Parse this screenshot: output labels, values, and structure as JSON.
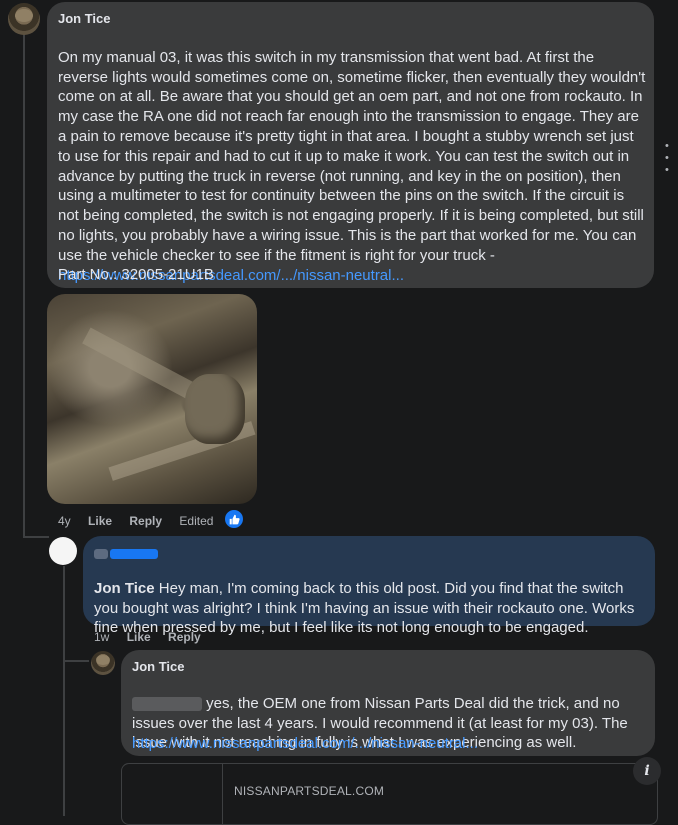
{
  "comment_1": {
    "author": "Jon Tice",
    "text": "On my manual 03, it was this switch in my transmission that went bad. At first the reverse lights would sometimes come on, sometime flicker, then eventually they wouldn't come on at all. Be aware that you should get an oem part, and not one from rockauto. In my case the RA one did not reach far enough into the transmission to engage. They are a pain to remove because it's pretty tight in that area. I bought a stubby wrench set just to use for this repair and had to cut it up to make it work. You can test the switch out in advance by putting the truck in reverse (not running, and key in the on position), then using a multimeter to test for continuity between the pins on the switch. If the circuit is not being completed, the switch is not engaging properly. If it is being completed, but still no lights, you probably have a wiring issue. This is the part that worked for me. You can use the vehicle checker to see if the fitment is right for your truck - ",
    "link": "https://www.nissanpartsdeal.com/.../nissan-neutral...",
    "part_no": "Part No.: 32005-21U1B",
    "meta": {
      "age": "4y",
      "like": "Like",
      "reply": "Reply",
      "edited": "Edited"
    }
  },
  "comment_2": {
    "author": "Jon Tice",
    "text": "Hey man, I'm coming back to this old post. Did you find that the switch you bought was alright? I think I'm having an issue with their rockauto one. Works fine when pressed by me, but I feel like its not long enough to be engaged.",
    "meta": {
      "age": "1w",
      "like": "Like",
      "reply": "Reply"
    }
  },
  "comment_3": {
    "author": "Jon Tice",
    "text": " yes, the OEM one from Nissan Parts Deal did the trick, and no issues over the last 4 years. I would recommend it (at least for my 03). The issue with it not reaching in fully is what I was experiencing as well.",
    "link": "https://www.nissanpartsdeal.com/.../nissan-neutral...",
    "card_domain": "NISSANPARTSDEAL.COM"
  },
  "colors": {
    "background": "#18191a",
    "bubble": "#3a3b3c",
    "highlight_bubble": "#263951",
    "link": "#4599ff"
  },
  "icons": {
    "reaction": "thumbs-up-icon",
    "info": "info-icon",
    "more": "more-options-icon"
  }
}
